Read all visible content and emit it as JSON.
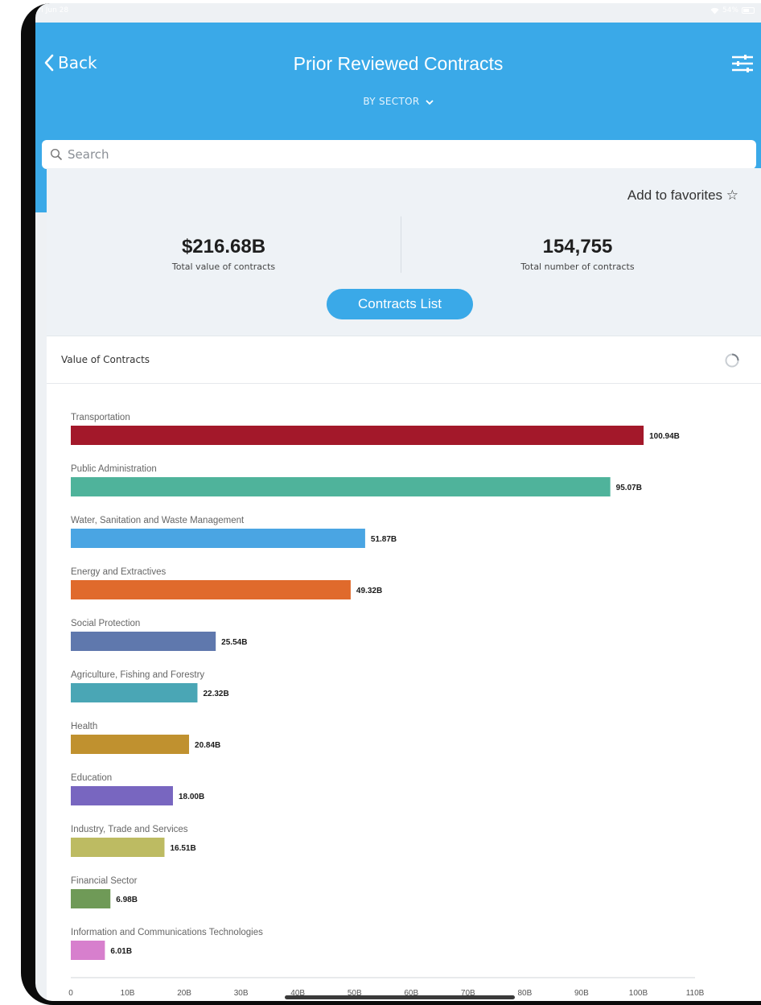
{
  "status_bar": {
    "time": "4:39 PM  Fri Jun 28",
    "battery": "54%"
  },
  "header": {
    "back_label": "Back",
    "title": "Prior Reviewed Contracts",
    "dropdown_label": "BY SECTOR",
    "search_placeholder": "Search"
  },
  "summary": {
    "favorites_label": "Add to favorites ☆",
    "total_value": "$216.68B",
    "total_value_label": "Total value of contracts",
    "total_number": "154,755",
    "total_number_label": "Total number of contracts",
    "contracts_list_label": "Contracts List"
  },
  "chart_card": {
    "title": "Value of Contracts"
  },
  "chart_data": {
    "type": "bar",
    "orientation": "horizontal",
    "categories": [
      "Transportation",
      "Public Administration",
      "Water, Sanitation and Waste Management",
      "Energy and Extractives",
      "Social Protection",
      "Agriculture, Fishing and Forestry",
      "Health",
      "Education",
      "Industry, Trade and Services",
      "Financial Sector",
      "Information and Communications Technologies"
    ],
    "values": [
      100.94,
      95.07,
      51.87,
      49.32,
      25.54,
      22.32,
      20.84,
      18.0,
      16.51,
      6.98,
      6.01
    ],
    "value_labels": [
      "100.94B",
      "95.07B",
      "51.87B",
      "49.32B",
      "25.54B",
      "22.32B",
      "20.84B",
      "18.00B",
      "16.51B",
      "6.98B",
      "6.01B"
    ],
    "colors": [
      "#a3182a",
      "#4fb39b",
      "#4aa5e3",
      "#e06a2c",
      "#5f78ad",
      "#4aa6b5",
      "#c0912f",
      "#7866c0",
      "#bdbb62",
      "#6f9a57",
      "#d77fcd"
    ],
    "xlim": [
      0,
      110
    ],
    "x_ticks": [
      0,
      10,
      20,
      30,
      40,
      50,
      60,
      70,
      80,
      90,
      100,
      110
    ],
    "x_tick_labels": [
      "0",
      "10B",
      "20B",
      "30B",
      "40B",
      "50B",
      "60B",
      "70B",
      "80B",
      "90B",
      "100B",
      "110B"
    ],
    "title": "Value of Contracts",
    "xlabel": "",
    "ylabel": ""
  }
}
